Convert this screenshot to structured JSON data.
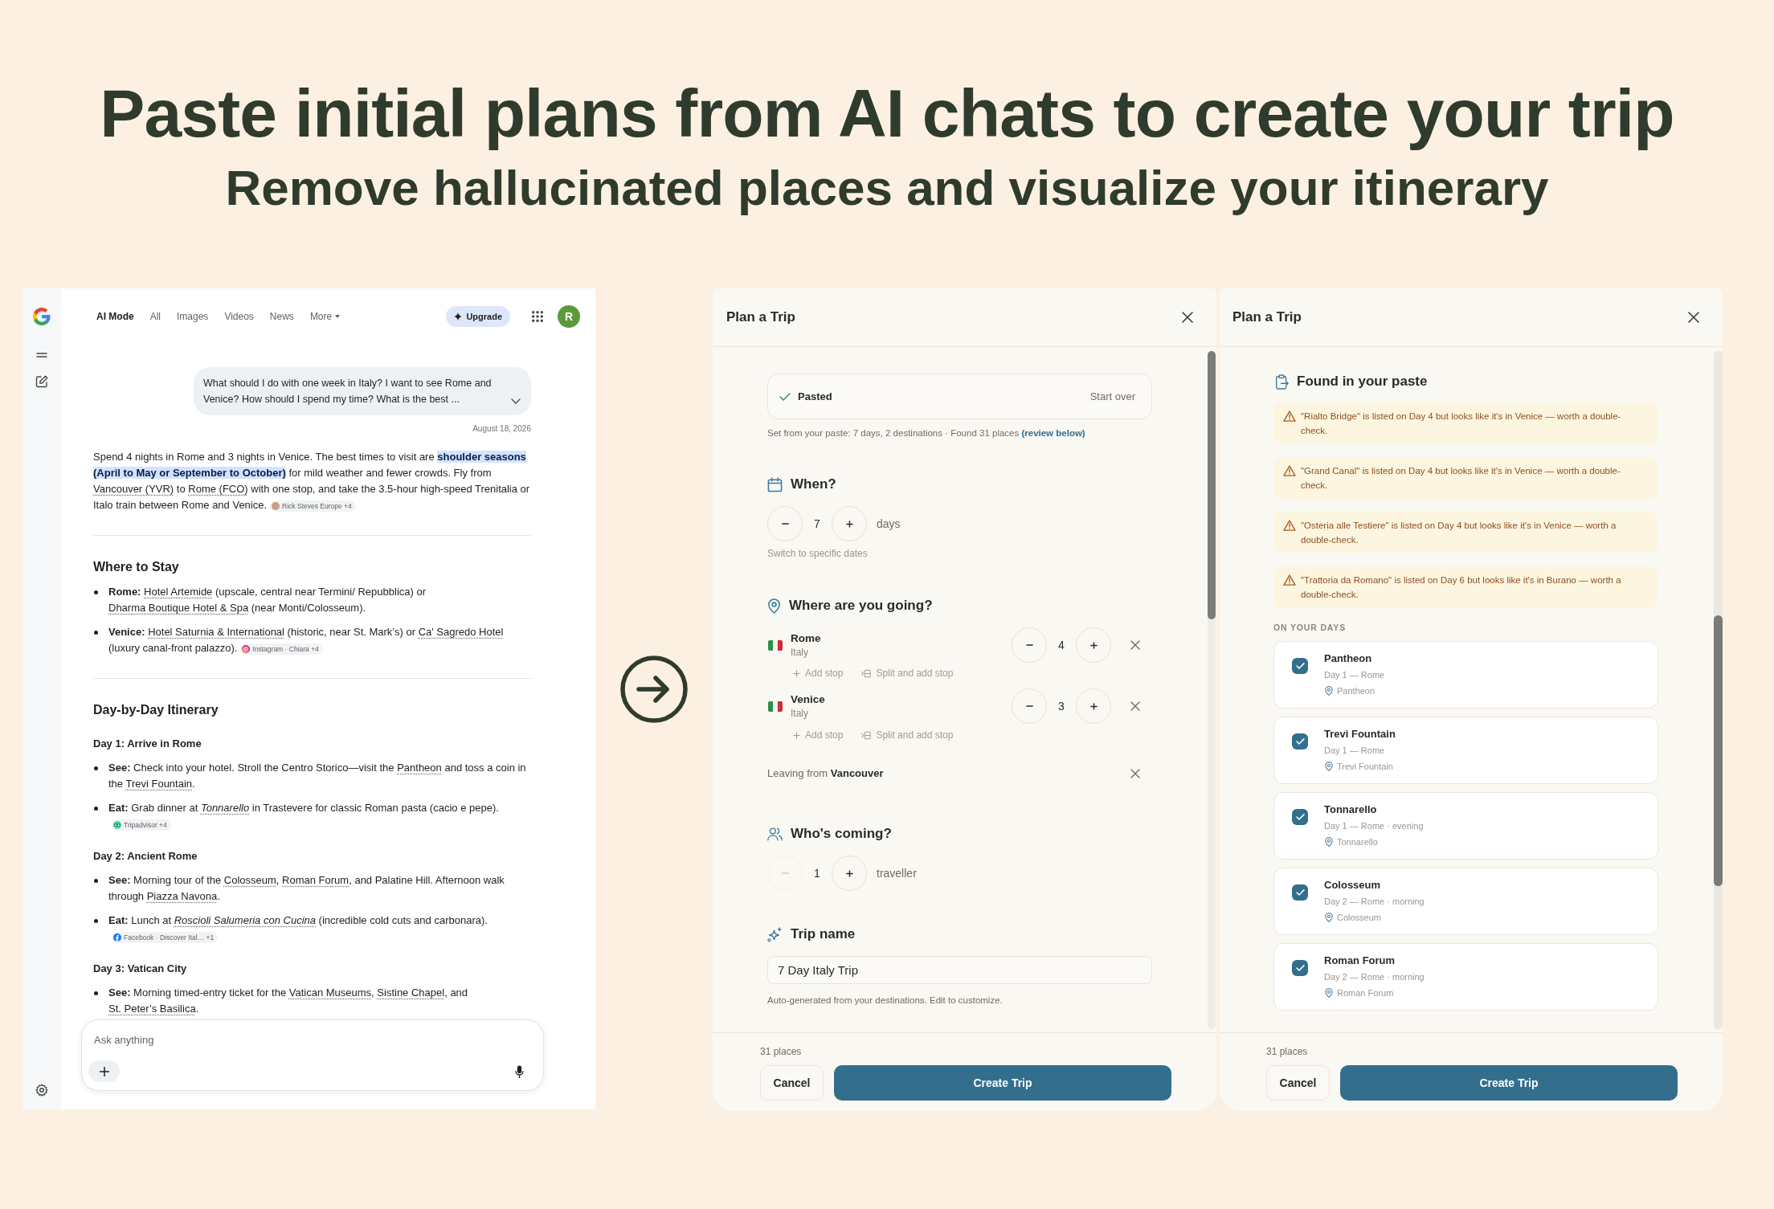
{
  "headline": {
    "title": "Paste initial plans from AI chats to create your trip",
    "subtitle": "Remove hallucinated places and visualize your itinerary"
  },
  "chat": {
    "tabs": [
      {
        "label": "AI Mode",
        "selected": true,
        "dropdown": false
      },
      {
        "label": "All",
        "selected": false,
        "dropdown": false
      },
      {
        "label": "Images",
        "selected": false,
        "dropdown": false
      },
      {
        "label": "Videos",
        "selected": false,
        "dropdown": false
      },
      {
        "label": "News",
        "selected": false,
        "dropdown": false
      },
      {
        "label": "More",
        "selected": false,
        "dropdown": true
      }
    ],
    "upgrade": "Upgrade",
    "avatar": "R",
    "query": "What should I do with one week in Italy? I want to see Rome and Venice? How should I spend my time? What is the best ...",
    "date": "August 18, 2026",
    "blocks": [
      {
        "kind": "paragraph",
        "runs": [
          {
            "kind": "text",
            "text": "Spend 4 nights in Rome and 3 nights in Venice. The best times to visit are "
          },
          {
            "kind": "highlight",
            "text": "shoulder seasons (April to May or September to October)"
          },
          {
            "kind": "text",
            "text": " for mild weather and fewer crowds. Fly from "
          },
          {
            "kind": "link",
            "text": "Vancouver (YVR)"
          },
          {
            "kind": "text",
            "text": " to "
          },
          {
            "kind": "link",
            "text": "Rome (FCO)"
          },
          {
            "kind": "text",
            "text": " with one stop, and take the 3.5-hour high-speed Trenitalia or Italo train between Rome and Venice."
          }
        ],
        "source": {
          "label": "Rick Steves Europe +4",
          "kind": "photo"
        }
      },
      {
        "kind": "divider"
      },
      {
        "kind": "heading",
        "text": "Where to Stay"
      },
      {
        "kind": "bullet",
        "label": "Rome:",
        "runs": [
          {
            "kind": "link",
            "text": "Hotel Artemide"
          },
          {
            "kind": "text",
            "text": " (upscale, central near Termini/ Repubblica) or "
          },
          {
            "kind": "link",
            "text": "Dharma Boutique Hotel & Spa"
          },
          {
            "kind": "text",
            "text": " (near Monti/Colosseum)."
          }
        ]
      },
      {
        "kind": "bullet",
        "label": "Venice:",
        "runs": [
          {
            "kind": "link",
            "text": "Hotel Saturnia & International"
          },
          {
            "kind": "text",
            "text": " (historic, near St. Mark’s) or "
          },
          {
            "kind": "link",
            "text": "Ca' Sagredo Hotel"
          },
          {
            "kind": "text",
            "text": " (luxury canal-front palazzo)."
          }
        ],
        "source": {
          "label": "Instagram · Chiara +4",
          "kind": "camera"
        }
      },
      {
        "kind": "divider"
      },
      {
        "kind": "heading",
        "text": "Day-by-Day Itinerary"
      },
      {
        "kind": "subheading",
        "text": "Day 1: Arrive in Rome"
      },
      {
        "kind": "bullet",
        "label": "See:",
        "runs": [
          {
            "kind": "text",
            "text": "Check into your hotel. Stroll the Centro Storico—visit the "
          },
          {
            "kind": "link",
            "text": "Pantheon"
          },
          {
            "kind": "text",
            "text": " and toss a coin in the "
          },
          {
            "kind": "link",
            "text": "Trevi Fountain"
          },
          {
            "kind": "text",
            "text": "."
          }
        ]
      },
      {
        "kind": "bullet",
        "label": "Eat:",
        "runs": [
          {
            "kind": "text",
            "text": "Grab dinner at "
          },
          {
            "kind": "italiclink",
            "text": "Tonnarello"
          },
          {
            "kind": "text",
            "text": " in Trastevere for classic Roman pasta (cacio e pepe)."
          }
        ],
        "source": {
          "label": "Tripadvisor +4",
          "kind": "owl"
        }
      },
      {
        "kind": "subheading",
        "text": "Day 2: Ancient Rome"
      },
      {
        "kind": "bullet",
        "label": "See:",
        "runs": [
          {
            "kind": "text",
            "text": "Morning tour of the "
          },
          {
            "kind": "link",
            "text": "Colosseum"
          },
          {
            "kind": "text",
            "text": ", "
          },
          {
            "kind": "link",
            "text": "Roman Forum"
          },
          {
            "kind": "text",
            "text": ", and Palatine Hill. Afternoon walk through "
          },
          {
            "kind": "link",
            "text": "Piazza Navona"
          },
          {
            "kind": "text",
            "text": "."
          }
        ]
      },
      {
        "kind": "bullet",
        "label": "Eat:",
        "runs": [
          {
            "kind": "text",
            "text": "Lunch at "
          },
          {
            "kind": "italiclink",
            "text": "Roscioli Salumeria con Cucina"
          },
          {
            "kind": "text",
            "text": " (incredible cold cuts and carbonara)."
          }
        ],
        "source": {
          "label": "Facebook · Discover Ital… +1",
          "kind": "facebook"
        }
      },
      {
        "kind": "subheading",
        "text": "Day 3: Vatican City"
      },
      {
        "kind": "bullet",
        "label": "See:",
        "runs": [
          {
            "kind": "text",
            "text": "Morning timed-entry ticket for the "
          },
          {
            "kind": "link",
            "text": "Vatican Museums"
          },
          {
            "kind": "text",
            "text": ", "
          },
          {
            "kind": "link",
            "text": "Sistine Chapel"
          },
          {
            "kind": "text",
            "text": ", and "
          },
          {
            "kind": "link",
            "text": "St. Peter’s Basilica"
          },
          {
            "kind": "text",
            "text": "."
          }
        ]
      }
    ],
    "composer": {
      "placeholder": "Ask anything"
    }
  },
  "plan": {
    "title": "Plan a Trip",
    "pasted": {
      "status": "Pasted",
      "action": "Start over"
    },
    "summary": {
      "text": "Set from your paste: 7 days, 2 destinations · Found 31 places",
      "link": "(review below)"
    },
    "when": {
      "heading": "When?",
      "value": "7",
      "unit": "days",
      "minus_disabled": false,
      "link": "Switch to specific dates"
    },
    "where": {
      "heading": "Where are you going?",
      "destinations": [
        {
          "city": "Rome",
          "country": "Italy",
          "nights": "4",
          "minus_disabled": false,
          "actions": [
            {
              "kind": "add",
              "label": "Add stop"
            },
            {
              "kind": "split",
              "label": "Split and add stop"
            }
          ]
        },
        {
          "city": "Venice",
          "country": "Italy",
          "nights": "3",
          "minus_disabled": false,
          "actions": [
            {
              "kind": "add",
              "label": "Add stop"
            },
            {
              "kind": "split",
              "label": "Split and add stop"
            }
          ]
        }
      ],
      "leaving": "Leaving from **Vancouver**"
    },
    "who": {
      "heading": "Who's coming?",
      "value": "1",
      "unit": "traveller",
      "minus_disabled": true
    },
    "trip_name": {
      "heading": "Trip name",
      "value": "7 Day Italy Trip",
      "hint": "Auto-generated from your destinations. Edit to customize."
    },
    "footer": {
      "count": "31 places",
      "cancel": "Cancel",
      "create": "Create Trip"
    }
  },
  "review": {
    "title": "Plan a Trip",
    "heading": "Found in your paste",
    "warnings": [
      "\"Rialto Bridge\" is listed on Day 4 but looks like it's in Venice — worth a double-check.",
      "\"Grand Canal\" is listed on Day 4 but looks like it's in Venice — worth a double-check.",
      "\"Osteria alle Testiere\" is listed on Day 4 but looks like it's in Venice — worth a double-check.",
      "\"Trattoria da Romano\" is listed on Day 6 but looks like it's in Burano — worth a double-check."
    ],
    "section_label": "ON YOUR DAYS",
    "places": [
      {
        "name": "Pantheon",
        "when": "Day 1 — Rome",
        "location": "Pantheon",
        "checked": true
      },
      {
        "name": "Trevi Fountain",
        "when": "Day 1 — Rome",
        "location": "Trevi Fountain",
        "checked": true
      },
      {
        "name": "Tonnarello",
        "when": "Day 1 — Rome · evening",
        "location": "Tonnarello",
        "checked": true
      },
      {
        "name": "Colosseum",
        "when": "Day 2 — Rome · morning",
        "location": "Colosseum",
        "checked": true
      },
      {
        "name": "Roman Forum",
        "when": "Day 2 — Rome · morning",
        "location": "Roman Forum",
        "checked": true
      }
    ],
    "footer": {
      "count": "31 places",
      "cancel": "Cancel",
      "create": "Create Trip"
    }
  }
}
